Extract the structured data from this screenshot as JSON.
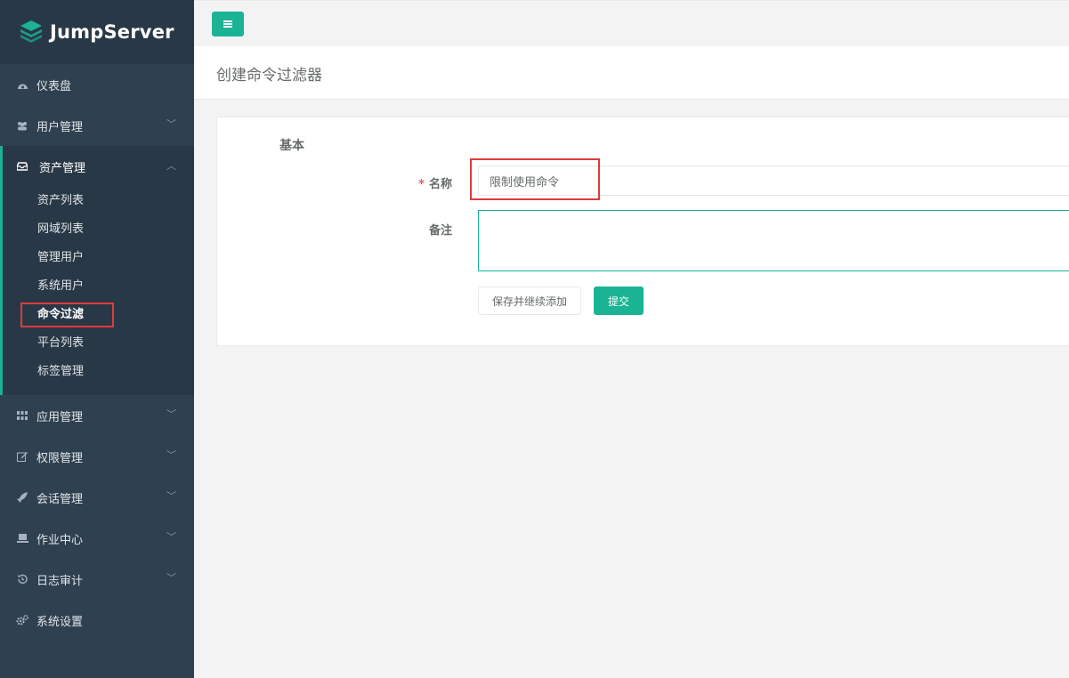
{
  "app": {
    "brand": "JumpServer",
    "accent_color": "#1ab394",
    "sidebar_bg": "#2f4050",
    "highlight_color": "#e03b3b"
  },
  "sidebar": {
    "items": [
      {
        "label": "仪表盘",
        "icon": "dashboard-icon"
      },
      {
        "label": "用户管理",
        "icon": "users-icon"
      },
      {
        "label": "资产管理",
        "icon": "inbox-icon"
      },
      {
        "label": "应用管理",
        "icon": "grid-icon"
      },
      {
        "label": "权限管理",
        "icon": "edit-icon"
      },
      {
        "label": "会话管理",
        "icon": "rocket-icon"
      },
      {
        "label": "作业中心",
        "icon": "laptop-icon"
      },
      {
        "label": "日志审计",
        "icon": "history-icon"
      },
      {
        "label": "系统设置",
        "icon": "gears-icon"
      }
    ],
    "asset_submenu": [
      "资产列表",
      "网域列表",
      "管理用户",
      "系统用户",
      "命令过滤",
      "平台列表",
      "标签管理"
    ]
  },
  "page": {
    "title": "创建命令过滤器"
  },
  "form": {
    "section_title": "基本",
    "required_mark": "*",
    "name_label": "名称",
    "name_value": "限制使用命令",
    "comment_label": "备注",
    "comment_value": "",
    "save_continue_label": "保存并继续添加",
    "submit_label": "提交"
  }
}
